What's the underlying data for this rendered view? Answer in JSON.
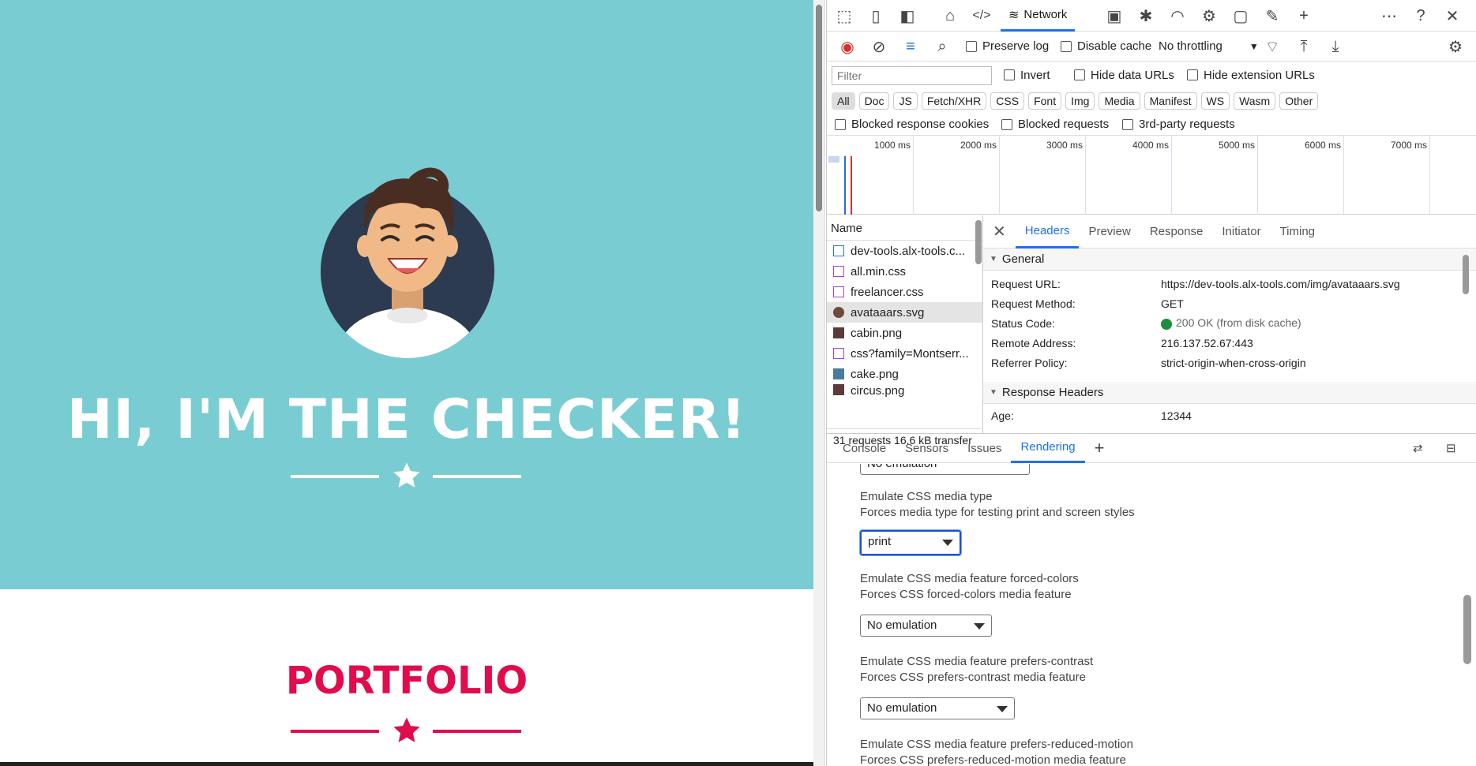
{
  "page": {
    "hero_title": "HI, I'M THE CHECKER!",
    "portfolio_title": "PORTFOLIO",
    "colors": {
      "hero_bg": "#79cdd2",
      "accent": "#e10c4c"
    }
  },
  "devtools": {
    "top_tabs": {
      "network_label": "Network"
    },
    "toolbar": {
      "preserve_log": "Preserve log",
      "disable_cache": "Disable cache",
      "throttling": "No throttling"
    },
    "filter": {
      "placeholder": "Filter",
      "invert": "Invert",
      "hide_data_urls": "Hide data URLs",
      "hide_extension_urls": "Hide extension URLs"
    },
    "type_chips": [
      "All",
      "Doc",
      "JS",
      "Fetch/XHR",
      "CSS",
      "Font",
      "Img",
      "Media",
      "Manifest",
      "WS",
      "Wasm",
      "Other"
    ],
    "blocked": {
      "cookies": "Blocked response cookies",
      "requests": "Blocked requests",
      "third_party": "3rd-party requests"
    },
    "timeline_ticks": [
      "1000 ms",
      "2000 ms",
      "3000 ms",
      "4000 ms",
      "5000 ms",
      "6000 ms",
      "7000 ms"
    ],
    "request_list": {
      "header": "Name",
      "items": [
        "dev-tools.alx-tools.c...",
        "all.min.css",
        "freelancer.css",
        "avataaars.svg",
        "cabin.png",
        "css?family=Montserr...",
        "cake.png",
        "circus.png"
      ],
      "footer": "31 requests  16.6 kB transfer"
    },
    "detail_tabs": [
      "Headers",
      "Preview",
      "Response",
      "Initiator",
      "Timing"
    ],
    "general": {
      "title": "General",
      "request_url_k": "Request URL:",
      "request_url_v": "https://dev-tools.alx-tools.com/img/avataaars.svg",
      "method_k": "Request Method:",
      "method_v": "GET",
      "status_k": "Status Code:",
      "status_v": "200 OK (from disk cache)",
      "remote_k": "Remote Address:",
      "remote_v": "216.137.52.67:443",
      "referrer_k": "Referrer Policy:",
      "referrer_v": "strict-origin-when-cross-origin"
    },
    "response_headers": {
      "title": "Response Headers",
      "age_k": "Age:",
      "age_v": "12344"
    },
    "drawer_tabs": [
      "Console",
      "Sensors",
      "Issues",
      "Rendering"
    ],
    "rendering": {
      "prev_select": "No emulation",
      "media_type_title": "Emulate CSS media type",
      "media_type_desc": "Forces media type for testing print and screen styles",
      "media_type_value": "print",
      "forced_colors_title": "Emulate CSS media feature forced-colors",
      "forced_colors_desc": "Forces CSS forced-colors media feature",
      "forced_colors_value": "No emulation",
      "contrast_title": "Emulate CSS media feature prefers-contrast",
      "contrast_desc": "Forces CSS prefers-contrast media feature",
      "contrast_value": "No emulation",
      "reduced_motion_title": "Emulate CSS media feature prefers-reduced-motion",
      "reduced_motion_desc": "Forces CSS prefers-reduced-motion media feature"
    }
  }
}
